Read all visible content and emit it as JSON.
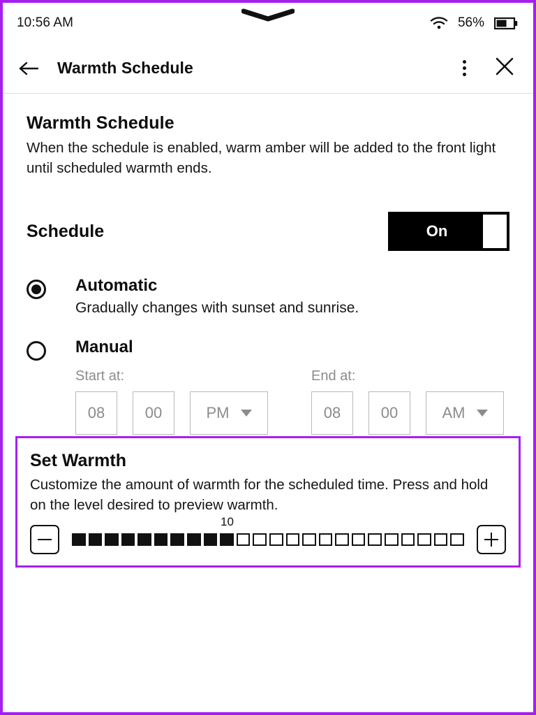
{
  "status_bar": {
    "time": "10:56 AM",
    "wifi_icon": "wifi-icon",
    "battery_percent": "56%",
    "battery_icon": "battery-icon",
    "notch_handle_icon": "chevron-down-handle-icon"
  },
  "app_bar": {
    "back_icon": "back-arrow-icon",
    "title": "Warmth Schedule",
    "overflow_icon": "more-vertical-icon",
    "close_icon": "close-icon"
  },
  "intro": {
    "title": "Warmth Schedule",
    "description": "When the schedule is enabled, warm amber will be added to the front light until scheduled warmth ends."
  },
  "schedule": {
    "label": "Schedule",
    "toggle_state": "On",
    "toggle_on": true
  },
  "options": [
    {
      "id": "automatic",
      "title": "Automatic",
      "subtitle": "Gradually changes with sunset and sunrise.",
      "selected": true
    },
    {
      "id": "manual",
      "title": "Manual",
      "subtitle": "",
      "selected": false
    }
  ],
  "time_pickers": {
    "start": {
      "label": "Start at:",
      "hour": "08",
      "minute": "00",
      "meridiem": "PM",
      "caret_icon": "chevron-down-icon"
    },
    "end": {
      "label": "End at:",
      "hour": "08",
      "minute": "00",
      "meridiem": "AM",
      "caret_icon": "chevron-down-icon"
    }
  },
  "set_warmth": {
    "title": "Set Warmth",
    "description": "Customize the amount of warmth for the scheduled time. Press and hold on the level desired to preview warmth.",
    "decrease_icon": "minus-icon",
    "increase_icon": "plus-icon",
    "value_label": "10",
    "value": 10,
    "max": 24,
    "segments_filled": 10,
    "segments_total": 24
  },
  "colors": {
    "accent_purple": "#a61ff0",
    "ink": "#111111",
    "muted_gray": "#8c8c8c",
    "field_border": "#b9b9b9"
  }
}
